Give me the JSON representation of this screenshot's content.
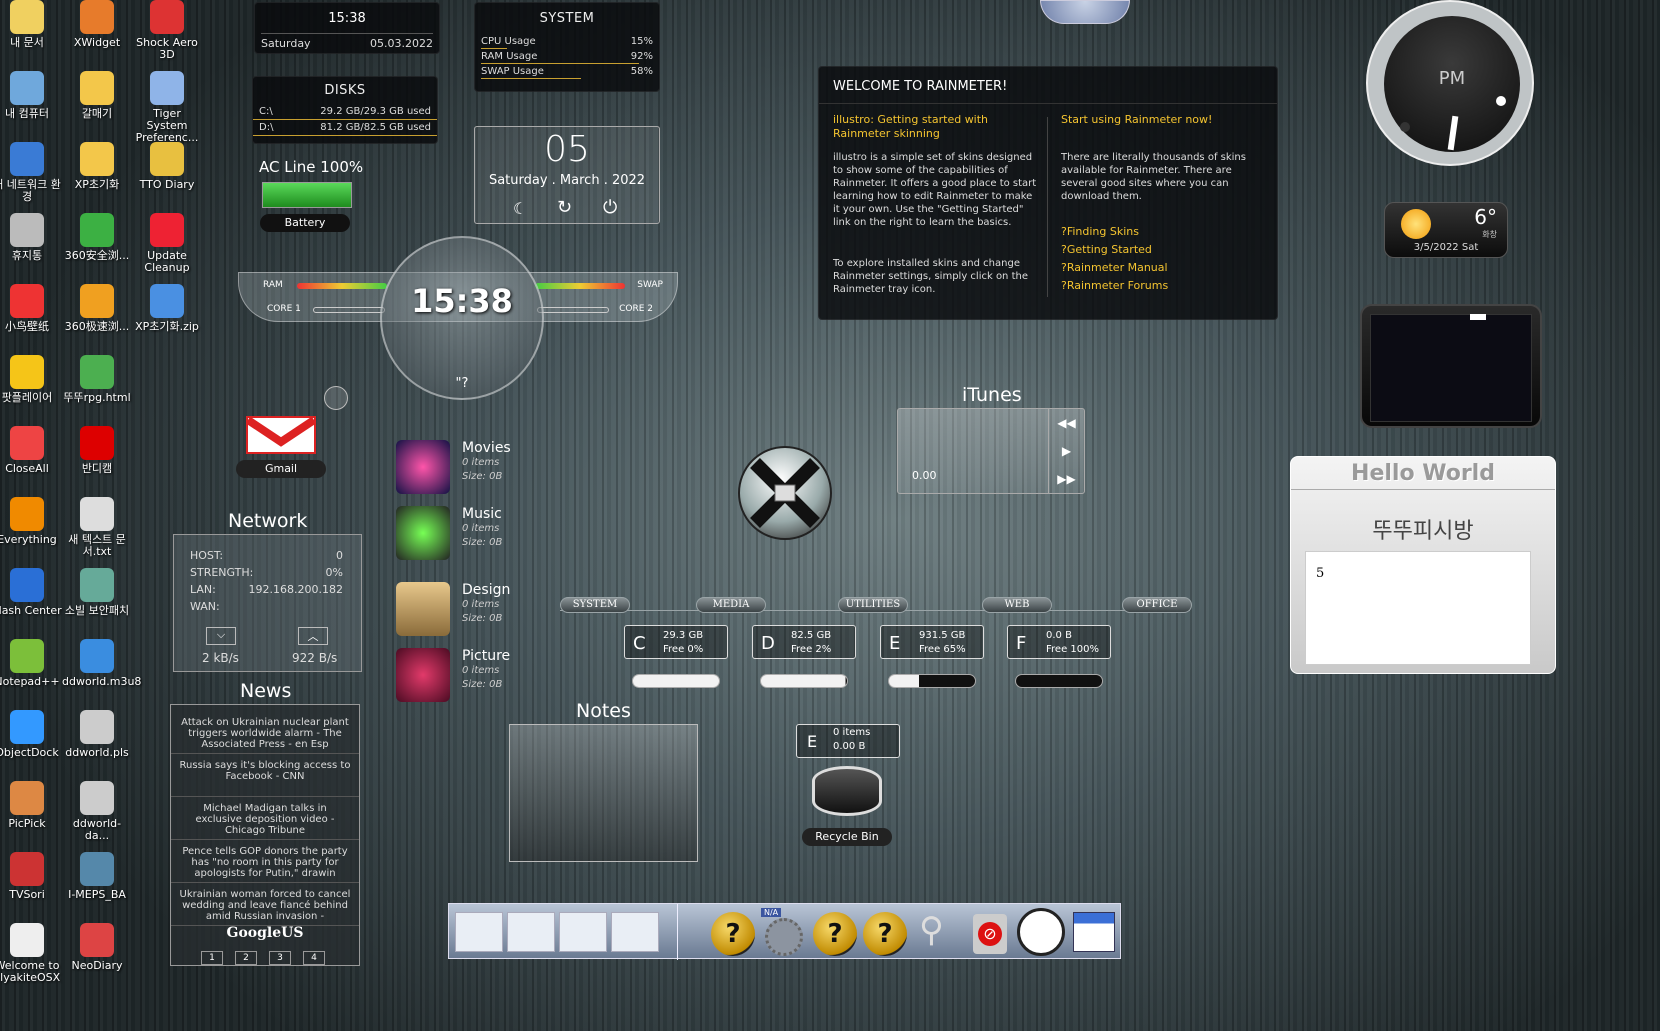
{
  "desktop_icons": [
    {
      "label": "내 문서",
      "icon": "folder-documents-icon",
      "color": "#f0d060"
    },
    {
      "label": "XWidget",
      "icon": "xwidget-icon",
      "color": "#e77b2b"
    },
    {
      "label": "Shock Aero 3D",
      "icon": "shock-aero-icon",
      "color": "#d33"
    },
    {
      "label": "내 컴퓨터",
      "icon": "computer-icon",
      "color": "#6fa8dc"
    },
    {
      "label": "갈매기",
      "icon": "folder-icon",
      "color": "#f3c74a"
    },
    {
      "label": "Tiger System Preferenc...",
      "icon": "tiger-system-icon",
      "color": "#8fb4e8"
    },
    {
      "label": "내 네트워크 환경",
      "icon": "network-globe-icon",
      "color": "#3a7bd5"
    },
    {
      "label": "XP초기화",
      "icon": "folder-icon",
      "color": "#f3c74a"
    },
    {
      "label": "TTO Diary",
      "icon": "diary-icon",
      "color": "#e8c040"
    },
    {
      "label": "휴지통",
      "icon": "recycle-bin-icon",
      "color": "#bbb"
    },
    {
      "label": "360安全浏...",
      "icon": "360-browser-icon",
      "color": "#3cb043"
    },
    {
      "label": "Update Cleanup",
      "icon": "shield-icon",
      "color": "#e23"
    },
    {
      "label": "小鸟壁纸",
      "icon": "bird-wallpaper-icon",
      "color": "#e33"
    },
    {
      "label": "360极速浏...",
      "icon": "360-speed-browser-icon",
      "color": "#f0a020"
    },
    {
      "label": "XP초기화.zip",
      "icon": "zip-icon",
      "color": "#4a90e2"
    },
    {
      "label": "팟플레이어",
      "icon": "potplayer-icon",
      "color": "#f5c518"
    },
    {
      "label": "뚜뚜rpg.html",
      "icon": "html-file-icon",
      "color": "#4caf50"
    },
    {
      "label": "CloseAll",
      "icon": "close-all-icon",
      "color": "#e44"
    },
    {
      "label": "반디캠",
      "icon": "bandicam-icon",
      "color": "#d00"
    },
    {
      "label": "Everything",
      "icon": "search-everything-icon",
      "color": "#f08a00"
    },
    {
      "label": "새 텍스트 문서.txt",
      "icon": "text-file-icon",
      "color": "#ddd"
    },
    {
      "label": "Flash Center",
      "icon": "flash-icon",
      "color": "#2a6fd6"
    },
    {
      "label": "소빌 보안패치",
      "icon": "security-patch-icon",
      "color": "#6a9"
    },
    {
      "label": "Notepad++",
      "icon": "notepadpp-icon",
      "color": "#7cbf3a"
    },
    {
      "label": "ddworld.m3u8",
      "icon": "play-file-icon",
      "color": "#3a8de0"
    },
    {
      "label": "ObjectDock",
      "icon": "objectdock-icon",
      "color": "#39f"
    },
    {
      "label": "ddworld.pls",
      "icon": "playlist-file-icon",
      "color": "#ccc"
    },
    {
      "label": "PicPick",
      "icon": "picpick-icon",
      "color": "#d84"
    },
    {
      "label": "ddworld-da...",
      "icon": "playlist-file-icon",
      "color": "#ccc"
    },
    {
      "label": "TVSori",
      "icon": "tv-icon",
      "color": "#c33"
    },
    {
      "label": "I-MEPS_BA",
      "icon": "headset-icon",
      "color": "#58a"
    },
    {
      "label": "Welcome to FlyakiteOSX",
      "icon": "document-icon",
      "color": "#eee"
    },
    {
      "label": "NeoDiary",
      "icon": "calendar-icon",
      "color": "#d44"
    }
  ],
  "clock_panel": {
    "time": "15:38",
    "day": "Saturday",
    "date": "05.03.2022"
  },
  "system_panel": {
    "title": "SYSTEM",
    "rows": [
      {
        "label": "CPU Usage",
        "value": "15%",
        "level": 0.15
      },
      {
        "label": "RAM Usage",
        "value": "92%",
        "level": 0.92
      },
      {
        "label": "SWAP Usage",
        "value": "58%",
        "level": 0.58
      }
    ]
  },
  "disks_panel": {
    "title": "DISKS",
    "rows": [
      {
        "label": "C:\\",
        "value": "29.2 GB/29.3 GB used"
      },
      {
        "label": "D:\\",
        "value": "81.2 GB/82.5 GB used"
      }
    ]
  },
  "power": {
    "label": "AC Line 100%",
    "battery_label": "Battery",
    "level": 1.0
  },
  "date_widget": {
    "day_number": "05",
    "date_line": "Saturday . March . 2022"
  },
  "gauge_clock": {
    "time": "15:38",
    "ram": "RAM",
    "swap": "SWAP",
    "core1": "CORE 1",
    "core2": "CORE 2",
    "footer": "\"?"
  },
  "gmail": {
    "label": "Gmail"
  },
  "network": {
    "title": "Network",
    "host_label": "HOST:",
    "host_value": "0",
    "strength_label": "STRENGTH:",
    "strength_value": "0%",
    "lan_label": "LAN:",
    "lan_value": "192.168.200.182",
    "wan_label": "WAN:",
    "down_rate": "2 kB/s",
    "up_rate": "922 B/s"
  },
  "news": {
    "title": "News",
    "items": [
      "Attack on Ukrainian nuclear plant triggers worldwide alarm - The Associated Press - en Esp",
      "Russia says it's blocking access to Facebook - CNN",
      "Michael Madigan talks in exclusive deposition video - Chicago Tribune",
      "Pence tells GOP donors the party has \"no room in this party for apologists for Putin,\" drawin",
      "Ukrainian woman forced to cancel wedding and leave fiancé behind amid Russian invasion -"
    ],
    "source": "GoogleUS",
    "pages": [
      "1",
      "2",
      "3",
      "4"
    ]
  },
  "media_library": [
    {
      "title": "Movies",
      "items": "0 items",
      "size": "Size: 0B",
      "icon": "movies-icon"
    },
    {
      "title": "Music",
      "items": "0 items",
      "size": "Size: 0B",
      "icon": "music-icon"
    },
    {
      "title": "Design",
      "items": "0 items",
      "size": "Size: 0B",
      "icon": "design-icon"
    },
    {
      "title": "Picture",
      "items": "0 items",
      "size": "Size: 0B",
      "icon": "picture-icon"
    }
  ],
  "itunes": {
    "title": "iTunes",
    "position": "0.00"
  },
  "categories": [
    "SYSTEM",
    "MEDIA",
    "UTILITIES",
    "WEB",
    "OFFICE"
  ],
  "drives": [
    {
      "letter": "C",
      "size": "29.3 GB",
      "free": "Free 0%",
      "free_level": 0.0
    },
    {
      "letter": "D",
      "size": "82.5 GB",
      "free": "Free 2%",
      "free_level": 0.02
    },
    {
      "letter": "E",
      "size": "931.5 GB",
      "free": "Free 65%",
      "free_level": 0.65
    },
    {
      "letter": "F",
      "size": "0.0 B",
      "free": "Free 100%",
      "free_level": 1.0
    }
  ],
  "recycle_bin": {
    "drive": "E",
    "items": "0 items",
    "size": "0.00 B",
    "label": "Recycle Bin"
  },
  "notes": {
    "title": "Notes"
  },
  "welcome": {
    "title": "WELCOME TO RAINMETER!",
    "left_heading": "illustro: Getting started with Rainmeter skinning",
    "left_body": "illustro is a simple set of skins designed to show some of the capabilities of Rainmeter. It offers a good place to start learning how to edit Rainmeter to make it your own. Use the \"Getting Started\" link on the right to learn the basics.",
    "left_body2": "To explore installed skins and change Rainmeter settings, simply click on the Rainmeter tray icon.",
    "right_heading": "Start using Rainmeter now!",
    "right_body": "There are literally thousands of skins available for Rainmeter. There are several good sites where you can download them.",
    "links": [
      "?Finding Skins",
      "?Getting Started",
      "?Rainmeter Manual",
      "?Rainmeter Forums"
    ]
  },
  "analog_clock": {
    "ampm": "PM"
  },
  "weather": {
    "temp": "6°",
    "condition": "화창",
    "date": "3/5/2022 Sat"
  },
  "hello_world": {
    "title": "Hello World",
    "subtitle": "뚜뚜피시방",
    "content": "5"
  },
  "dock": {
    "na_label": "N/A",
    "items": [
      "window-thumb-1",
      "window-thumb-2",
      "window-thumb-3",
      "window-thumb-4",
      "help-icon",
      "gear-icon",
      "help-icon",
      "help-icon",
      "magnifier-icon",
      "remove-icon",
      "clock-icon",
      "calendar-icon"
    ]
  },
  "colors": {
    "accent_gold": "#f4c430",
    "panel_bg": "#0a0c0e"
  }
}
